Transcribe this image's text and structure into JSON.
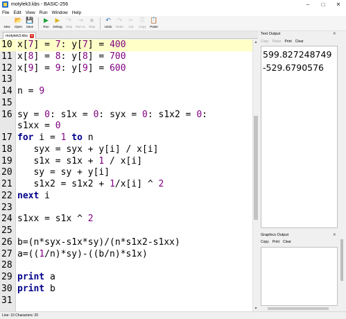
{
  "window": {
    "title": "motylek3.kbs - BASIC-256",
    "minimize_glyph": "–",
    "maximize_glyph": "□",
    "close_glyph": "✕"
  },
  "menu": [
    "File",
    "Edit",
    "View",
    "Run",
    "Window",
    "Help"
  ],
  "toolbar": {
    "buttons": [
      {
        "label": "New",
        "icon": "new-file-icon",
        "glyph": "🗋",
        "color": "#f2f2f2"
      },
      {
        "label": "Open",
        "icon": "open-folder-icon",
        "glyph": "📂",
        "color": "#e7b84a"
      },
      {
        "label": "Save",
        "icon": "save-icon",
        "glyph": "💾",
        "color": "#3b6fb6"
      },
      {
        "label": "Run",
        "icon": "run-icon",
        "glyph": "▶",
        "color": "#1aa33a"
      },
      {
        "label": "Debug",
        "icon": "debug-icon",
        "glyph": "▶",
        "color": "#d9b21c"
      },
      {
        "label": "Step",
        "icon": "step-icon",
        "glyph": "↷",
        "color": "#9a9a9a"
      },
      {
        "label": "Run to",
        "icon": "run-to-icon",
        "glyph": "⇥",
        "color": "#9a9a9a"
      },
      {
        "label": "Stop",
        "icon": "stop-icon",
        "glyph": "■",
        "color": "#9a9a9a"
      },
      {
        "label": "Undo",
        "icon": "undo-icon",
        "glyph": "↶",
        "color": "#2d6fbf"
      },
      {
        "label": "Redo",
        "icon": "redo-icon",
        "glyph": "↷",
        "color": "#9a9a9a"
      },
      {
        "label": "Cut",
        "icon": "cut-icon",
        "glyph": "✂",
        "color": "#9a9a9a"
      },
      {
        "label": "Copy",
        "icon": "copy-icon",
        "glyph": "⎘",
        "color": "#9a9a9a"
      },
      {
        "label": "Paste",
        "icon": "paste-icon",
        "glyph": "📋",
        "color": "#b07a2e"
      }
    ]
  },
  "tab": {
    "label": "motylek3.kbs"
  },
  "editor": {
    "current_line": 10,
    "lines": [
      {
        "n": "10",
        "code": "x[7] = 7: y[7] = 400"
      },
      {
        "n": "11",
        "code": "x[8] = 8: y[8] = 700"
      },
      {
        "n": "12",
        "code": "x[9] = 9: y[9] = 600"
      },
      {
        "n": "13",
        "code": ""
      },
      {
        "n": "14",
        "code": "n = 9"
      },
      {
        "n": "15",
        "code": ""
      },
      {
        "n": "16",
        "code": "sy = 0: s1x = 0: syx = 0: s1x2 = 0:"
      },
      {
        "n": "",
        "code": "s1xx = 0"
      },
      {
        "n": "17",
        "code": "for i = 1 to n"
      },
      {
        "n": "18",
        "code": "   syx = syx + y[i] / x[i]"
      },
      {
        "n": "19",
        "code": "   s1x = s1x + 1 / x[i]"
      },
      {
        "n": "20",
        "code": "   sy = sy + y[i]"
      },
      {
        "n": "21",
        "code": "   s1x2 = s1x2 + 1/x[i] ^ 2"
      },
      {
        "n": "22",
        "code": "next i"
      },
      {
        "n": "23",
        "code": ""
      },
      {
        "n": "24",
        "code": "s1xx = s1x ^ 2"
      },
      {
        "n": "25",
        "code": ""
      },
      {
        "n": "26",
        "code": "b=(n*syx-s1x*sy)/(n*s1x2-s1xx)"
      },
      {
        "n": "27",
        "code": "a=((1/n)*sy)-((b/n)*s1x)"
      },
      {
        "n": "28",
        "code": ""
      },
      {
        "n": "29",
        "code": "print a"
      },
      {
        "n": "30",
        "code": "print b"
      },
      {
        "n": "31",
        "code": ""
      }
    ]
  },
  "text_output": {
    "title": "Text Output",
    "toolbar": [
      "Copy",
      "Paste",
      "Print",
      "Clear"
    ],
    "lines": [
      "599.827248749",
      "-529.6790576"
    ]
  },
  "graphics_output": {
    "title": "Graphics Output",
    "toolbar": [
      "Copy",
      "Print",
      "Clear"
    ]
  },
  "status": "Line: 10 Characters: 20",
  "colors": {
    "keyword": "#00008b",
    "number": "#800080",
    "current_line_bg": "#ffffc8"
  }
}
